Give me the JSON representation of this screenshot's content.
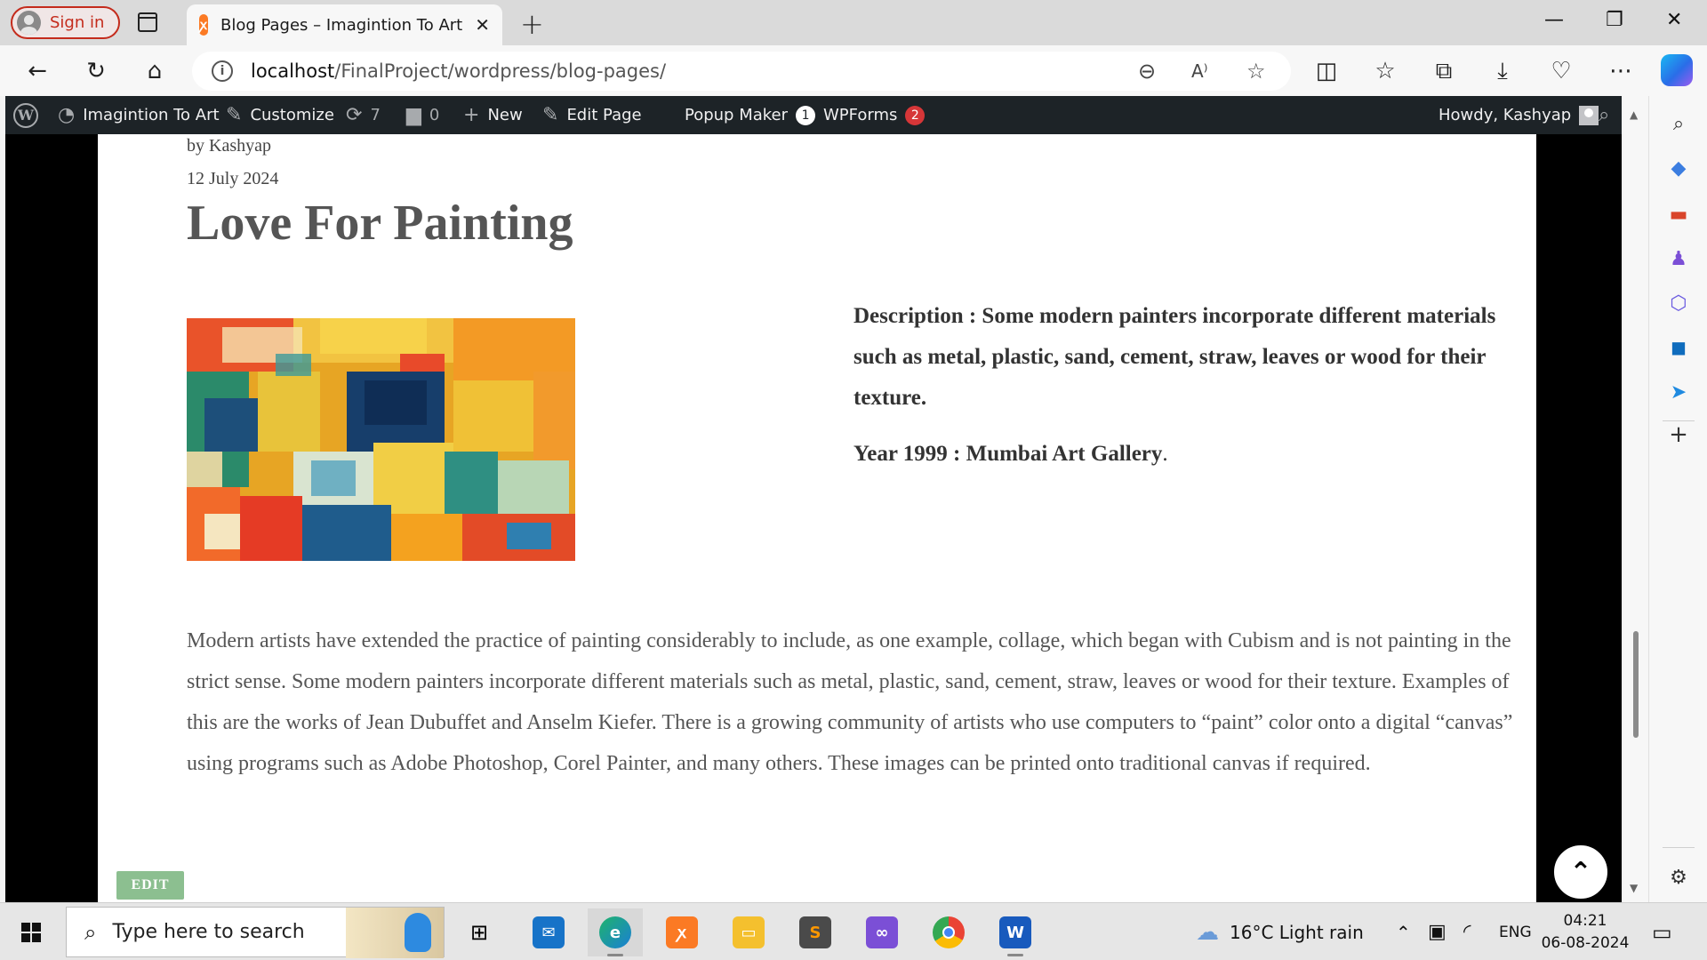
{
  "browser": {
    "sign_in": "Sign in",
    "tab_title": "Blog Pages – Imagintion To Art",
    "url_host": "localhost",
    "url_path": "/FinalProject/wordpress/blog-pages/"
  },
  "adminbar": {
    "site_name": "Imagintion To Art",
    "customize": "Customize",
    "updates_count": "7",
    "comments_count": "0",
    "new": "New",
    "edit_page": "Edit Page",
    "popup_maker": "Popup Maker",
    "popup_maker_badge": "1",
    "wpforms": "WPForms",
    "wpforms_badge": "2",
    "howdy": "Howdy, Kashyap"
  },
  "post": {
    "byline": "by Kashyap",
    "date": "12 July 2024",
    "title": "Love For Painting",
    "description": "Description : Some modern painters incorporate different materials such as metal, plastic, sand, cement, straw, leaves or wood for their texture.",
    "year_label": "Year 1999 : Mumbai Art Gallery",
    "year_suffix": ".",
    "body": "Modern artists have extended the practice of painting considerably to include, as one example, collage, which began with Cubism and is not painting in the strict sense. Some modern painters incorporate different materials such as metal, plastic, sand, cement, straw, leaves or wood for their texture. Examples of this are the works of Jean Dubuffet and Anselm Kiefer. There is a growing community of artists who use computers to “paint” color onto a digital “canvas” using programs such as Adobe Photoshop, Corel Painter, and many others. These images can be printed onto traditional canvas if required.",
    "edit_label": "EDIT"
  },
  "taskbar": {
    "search_placeholder": "Type here to search",
    "weather": "16°C  Light rain",
    "language": "ENG",
    "time": "04:21",
    "date": "06-08-2024"
  }
}
